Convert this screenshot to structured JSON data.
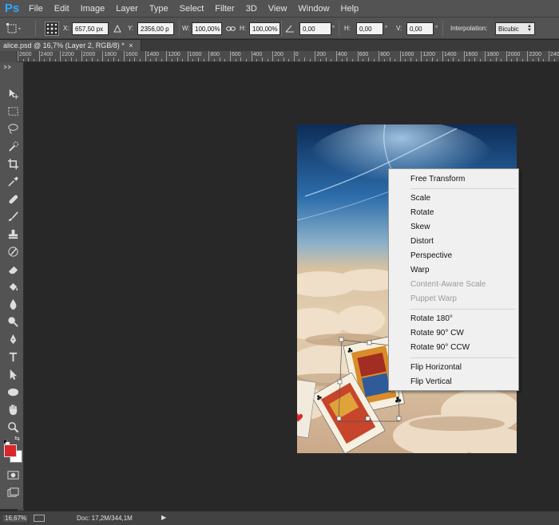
{
  "app": {
    "logo": "Ps"
  },
  "menu": [
    "File",
    "Edit",
    "Image",
    "Layer",
    "Type",
    "Select",
    "Filter",
    "3D",
    "View",
    "Window",
    "Help"
  ],
  "options": {
    "x_label": "X:",
    "x_value": "657,50 px",
    "y_label": "Y:",
    "y_value": "2356,00 p",
    "w_label": "W:",
    "w_value": "100,00%",
    "h_label": "H:",
    "h_value": "100,00%",
    "angle_value": "0,00",
    "hskew_label": "H:",
    "hskew_value": "0,00",
    "vskew_label": "V:",
    "vskew_value": "0,00",
    "degree_symbol": "°",
    "interp_label": "Interpolation:",
    "interp_value": "Bicubic"
  },
  "document_tab": {
    "title": "alice.psd @ 16,7% (Layer 2, RGB/8) *",
    "close": "×"
  },
  "ruler_labels": [
    "2600",
    "2400",
    "2200",
    "2000",
    "1800",
    "1600",
    "1400",
    "1200",
    "1000",
    "800",
    "600",
    "400",
    "200",
    "0",
    "200",
    "400",
    "600",
    "800",
    "1000",
    "1200",
    "1400",
    "1600",
    "1800",
    "2000",
    "2200",
    "2400"
  ],
  "tools": [
    "move-tool",
    "marquee-tool",
    "lasso-tool",
    "quick-select-tool",
    "crop-tool",
    "eyedropper-tool",
    "healing-brush-tool",
    "brush-tool",
    "clone-stamp-tool",
    "history-brush-tool",
    "eraser-tool",
    "paint-bucket-tool",
    "blur-tool",
    "dodge-tool",
    "pen-tool",
    "type-tool",
    "path-select-tool",
    "ellipse-tool",
    "hand-tool",
    "zoom-tool"
  ],
  "colors": {
    "foreground": "#d8262a",
    "background": "#ffffff",
    "accent": "#31a8ff"
  },
  "context_menu": {
    "group1": [
      "Free Transform"
    ],
    "group2": [
      {
        "label": "Scale",
        "enabled": true
      },
      {
        "label": "Rotate",
        "enabled": true
      },
      {
        "label": "Skew",
        "enabled": true
      },
      {
        "label": "Distort",
        "enabled": true
      },
      {
        "label": "Perspective",
        "enabled": true
      },
      {
        "label": "Warp",
        "enabled": true
      },
      {
        "label": "Content-Aware Scale",
        "enabled": false
      },
      {
        "label": "Puppet Warp",
        "enabled": false
      }
    ],
    "group3": [
      "Rotate 180°",
      "Rotate 90° CW",
      "Rotate 90° CCW"
    ],
    "group4": [
      "Flip Horizontal",
      "Flip Vertical"
    ]
  },
  "status": {
    "zoom": "16,67%",
    "doc": "Doc: 17,2M/344,1M",
    "arrow": "▶"
  }
}
